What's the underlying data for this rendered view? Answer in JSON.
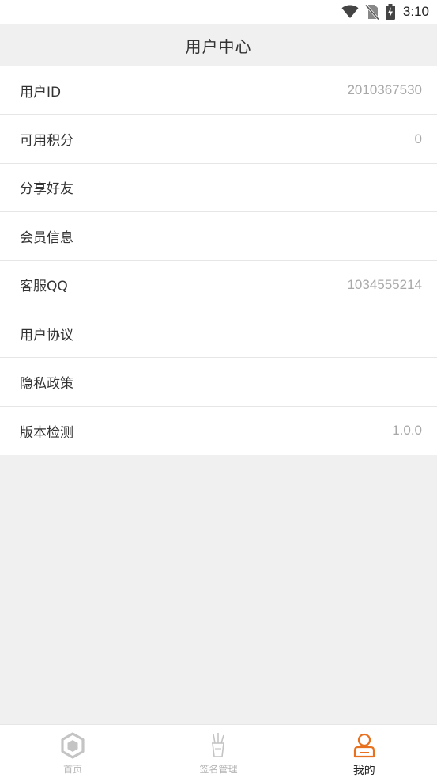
{
  "status_bar": {
    "time": "3:10",
    "icons": [
      "wifi-icon",
      "no-sim-icon",
      "battery-charging-icon"
    ]
  },
  "header": {
    "title": "用户中心"
  },
  "menu": {
    "items": [
      {
        "label": "用户ID",
        "value": "2010367530"
      },
      {
        "label": "可用积分",
        "value": "0"
      },
      {
        "label": "分享好友",
        "value": ""
      },
      {
        "label": "会员信息",
        "value": ""
      },
      {
        "label": "客服QQ",
        "value": "1034555214"
      },
      {
        "label": "用户协议",
        "value": ""
      },
      {
        "label": "隐私政策",
        "value": ""
      },
      {
        "label": "版本检测",
        "value": "1.0.0"
      }
    ]
  },
  "tabbar": {
    "tabs": [
      {
        "label": "首页",
        "icon": "home-cube-icon",
        "active": false
      },
      {
        "label": "签名管理",
        "icon": "pen-holder-icon",
        "active": false
      },
      {
        "label": "我的",
        "icon": "user-icon",
        "active": true
      }
    ]
  },
  "colors": {
    "accent": "#e8711f",
    "inactive_icon": "#c4c4c4",
    "background": "#f0f0f0",
    "value_text": "#a8a8a8"
  }
}
